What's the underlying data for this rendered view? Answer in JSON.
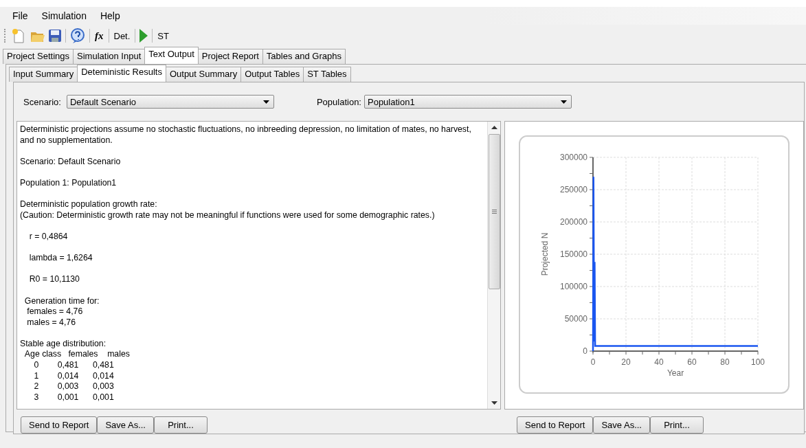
{
  "menu": [
    "File",
    "Simulation",
    "Help"
  ],
  "toolbar": [
    {
      "kind": "icon"
    },
    {
      "kind": "icon"
    },
    {
      "kind": "icon"
    },
    {
      "kind": "separator"
    },
    {
      "kind": "icon"
    },
    {
      "kind": "separator"
    },
    {
      "kind": "text",
      "label": "fx",
      "italic": true
    },
    {
      "kind": "separator"
    },
    {
      "kind": "text",
      "label": "Det.",
      "italic": false
    },
    {
      "kind": "separator"
    },
    {
      "kind": "icon"
    },
    {
      "kind": "separator"
    },
    {
      "kind": "text",
      "label": "ST",
      "italic": false
    }
  ],
  "tabs": [
    {
      "label": "Project Settings",
      "selected": false
    },
    {
      "label": "Simulation Input",
      "selected": false
    },
    {
      "label": "Text Output",
      "selected": true
    },
    {
      "label": "Project Report",
      "selected": false
    },
    {
      "label": "Tables and Graphs",
      "selected": false
    }
  ],
  "subtabs": [
    {
      "label": "Input Summary",
      "selected": false
    },
    {
      "label": "Deteministic Results",
      "selected": true
    },
    {
      "label": "Output Summary",
      "selected": false
    },
    {
      "label": "Output Tables",
      "selected": false
    },
    {
      "label": "ST Tables",
      "selected": false
    }
  ],
  "scenario": {
    "label": "Scenario:",
    "value": "Default Scenario"
  },
  "population": {
    "label": "Population:",
    "value": "Population1"
  },
  "text_output": {
    "blocks": [
      [
        "Deterministic projections assume no stochastic fluctuations, no inbreeding depression, no limitation of mates, no harvest, and no supplementation."
      ],
      [
        "Scenario: Default Scenario"
      ],
      [
        "Population 1: Population1"
      ],
      [
        "Deterministic population growth rate:",
        "(Caution: Deterministic growth rate may not be meaningful if functions were used for some demographic rates.)"
      ],
      [
        "    r = 0,4864"
      ],
      [
        "    lambda = 1,6264"
      ],
      [
        "    R0 = 10,1130"
      ],
      [
        "  Generation time for:",
        "   females = 4,76",
        "   males = 4,76"
      ],
      [
        "Stable age distribution:",
        "  Age class   females    males",
        "      0        0,481      0,481",
        "      1        0,014      0,014",
        "      2        0,003      0,003",
        "      3        0,001      0,001"
      ]
    ]
  },
  "left_buttons": [
    "Send to Report",
    "Save As...",
    "Print..."
  ],
  "chart": {
    "chart_data": {
      "type": "line",
      "xlabel": "Year",
      "ylabel": "Projected N",
      "x": [
        0,
        0.3,
        0.7,
        1,
        1.3,
        100
      ],
      "series": [
        {
          "color": "#1a56f0",
          "values": [
            0,
            270000,
            15000,
            138000,
            8000,
            8000
          ]
        }
      ],
      "grid": true,
      "xlim": [
        0,
        100
      ],
      "ylim": [
        0,
        300000
      ],
      "xticks": [
        0,
        20,
        40,
        60,
        80,
        100
      ],
      "yticks": [
        0,
        50000,
        100000,
        150000,
        200000,
        250000,
        300000
      ]
    }
  },
  "right_buttons": [
    "Send to Report",
    "Save As...",
    "Print..."
  ]
}
